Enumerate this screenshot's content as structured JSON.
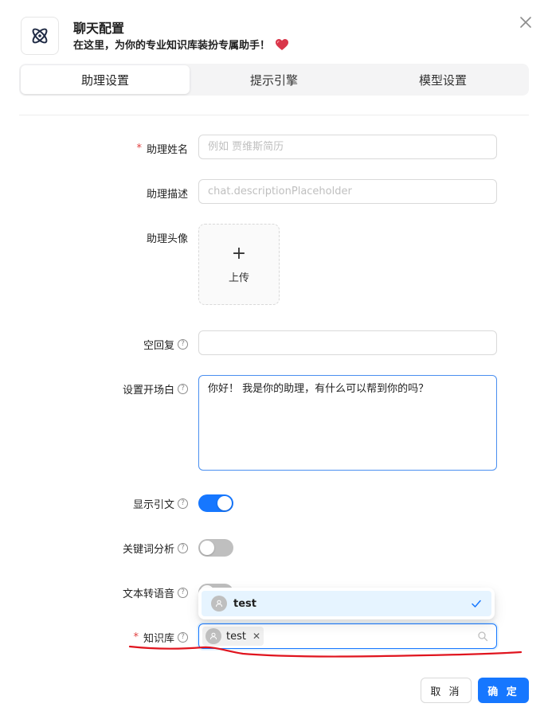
{
  "header": {
    "title": "聊天配置",
    "subtitle": "在这里，为你的专业知识库装扮专属助手！",
    "icon": "atom-icon",
    "sub_icon": "heart-icon"
  },
  "tabs": [
    {
      "label": "助理设置",
      "active": true
    },
    {
      "label": "提示引擎",
      "active": false
    },
    {
      "label": "模型设置",
      "active": false
    }
  ],
  "form": {
    "name_label": "助理姓名",
    "name_placeholder": "例如 贾维斯简历",
    "desc_label": "助理描述",
    "desc_placeholder": "chat.descriptionPlaceholder",
    "avatar_label": "助理头像",
    "upload_label": "上传",
    "empty_label": "空回复",
    "empty_value": "",
    "opener_label": "设置开场白",
    "opener_value": "你好！ 我是你的助理，有什么可以帮到你的吗？",
    "quote_label": "显示引文",
    "quote_on": true,
    "keyword_label": "关键词分析",
    "keyword_on": false,
    "tts_label": "文本转语音",
    "tts_on": false,
    "kb_label": "知识库",
    "kb_dropdown_option": "test",
    "kb_selected_tag": "test",
    "required_mark": "*"
  },
  "footer": {
    "cancel_label": "取 消",
    "ok_label": "确 定"
  },
  "colors": {
    "primary": "#1677ff",
    "required": "#e03e3e",
    "annotation": "#e0141e"
  }
}
